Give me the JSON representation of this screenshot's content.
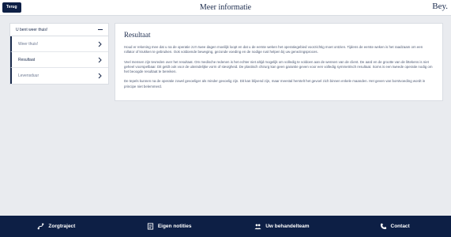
{
  "header": {
    "back_label": "Terug",
    "title": "Meer informatie",
    "brand": "Bey."
  },
  "sidebar": {
    "header_label": "U bent weer thuis!",
    "items": [
      {
        "label": "Weer thuis!"
      },
      {
        "label": "Resultaat"
      },
      {
        "label": "Levensduur"
      }
    ]
  },
  "content": {
    "title": "Resultaat",
    "paragraphs": [
      "Houd er rekening mee dat u na de operatie zo'n twee dagen moeilijk loopt en dat u de eerste weken het operatiegebied voorzichtig moet ontzien. Tijdens de eerste weken is het raadzaam om een rollator of krukken te gebruiken. Ook voldoende beweging, gezonde voeding en de nodige rust helpen bij uw genezingsproces.",
      "Veel mensen zijn tevreden over het resultaat. Om medische redenen is het echter niet altijd mogelijk om volledig te voldoen aan de wensen van de client. De aard en de grootte van de littekens is niet geheel voorspelbaar. Dit geldt ook voor de uiteindelijke vorm of stevigheid. De plastisch chirurg kan geen garantie geven voor een volledig symmetrisch resultaat. Soms is een tweede operatie nodig om het beoogde resultaat te bereiken.",
      "De tepels kunnen na de operatie zowel gevoeliger als minder gevoelig zijn. Dit kan blijvend zijn, maar meestal herstelt het gevoel zich binnen enkele maanden. Het geven van borstvoeding wordt in principe niet belemmerd."
    ]
  },
  "bottom_nav": {
    "items": [
      {
        "label": "Zorgtraject",
        "icon": "route-icon"
      },
      {
        "label": "Eigen notities",
        "icon": "notes-icon"
      },
      {
        "label": "Uw behandelteam",
        "icon": "team-icon"
      },
      {
        "label": "Contact",
        "icon": "phone-icon"
      }
    ]
  },
  "colors": {
    "navy": "#0d1f45",
    "background": "#e9ebef",
    "text": "#1b2b4d"
  }
}
